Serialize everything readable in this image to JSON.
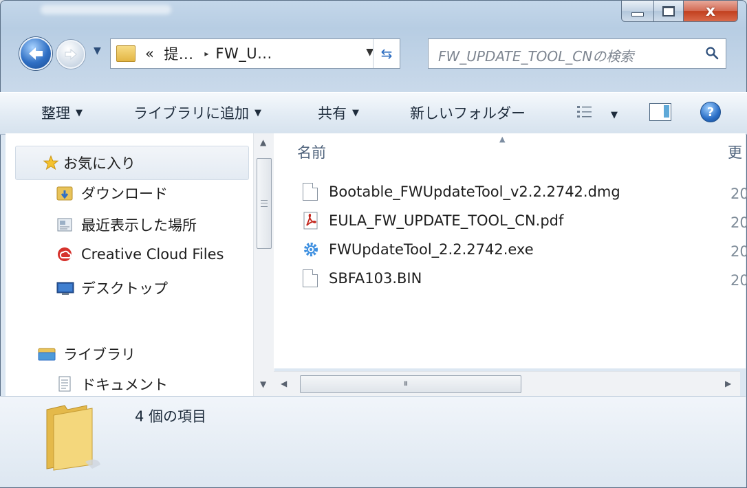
{
  "window": {
    "controls": {
      "minimize": "minimize-icon",
      "maximize": "maximize-icon",
      "close": "x"
    }
  },
  "address_bar": {
    "overflow": "«",
    "crumb1": "提...",
    "sep": "▸",
    "crumb2": "FW_U..."
  },
  "search": {
    "placeholder": "FW_UPDATE_TOOL_CNの検索"
  },
  "toolbar": {
    "organize": "整理",
    "add_to_library": "ライブラリに追加",
    "share": "共有",
    "new_folder": "新しいフォルダー"
  },
  "sidebar": {
    "favorites": "お気に入り",
    "downloads": "ダウンロード",
    "recent": "最近表示した場所",
    "creative_cloud": "Creative Cloud Files",
    "desktop": "デスクトップ",
    "libraries": "ライブラリ",
    "documents": "ドキュメント"
  },
  "columns": {
    "name": "名前",
    "modified": "更"
  },
  "files": [
    {
      "name": "Bootable_FWUpdateTool_v2.2.2742.dmg",
      "date": "20",
      "icon": "generic-file-icon"
    },
    {
      "name": "EULA_FW_UPDATE_TOOL_CN.pdf",
      "date": "20",
      "icon": "pdf-icon"
    },
    {
      "name": "FWUpdateTool_2.2.2742.exe",
      "date": "20",
      "icon": "gear-exe-icon"
    },
    {
      "name": "SBFA103.BIN",
      "date": "20",
      "icon": "generic-file-icon"
    }
  ],
  "details": {
    "item_count": "4 個の項目"
  },
  "scroll": {
    "hgrip": "III"
  },
  "colors": {
    "accent": "#2f6fc4",
    "toolbar_bg": "#e2ebf4",
    "frame": "#c4d7ea"
  }
}
